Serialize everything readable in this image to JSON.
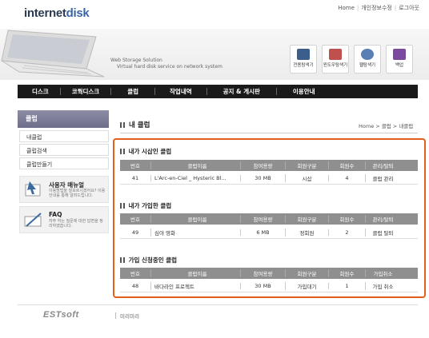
{
  "header": {
    "logo_part1": "internet",
    "logo_part2": "disk",
    "links": [
      "Home",
      "개인정보수정",
      "로그아웃"
    ]
  },
  "hero": {
    "slogan_line1": "Web Storage Solution",
    "slogan_line2": "Virtual hard disk service on network system",
    "quick_icons": [
      {
        "label": "전용탐색기",
        "icon": "monitor-icon",
        "color": "#3c5e8c"
      },
      {
        "label": "윈도우탐색기",
        "icon": "window-icon",
        "color": "#c0504d"
      },
      {
        "label": "웹탐색기",
        "icon": "web-search-icon",
        "color": "#5a7fb5"
      },
      {
        "label": "백업",
        "icon": "backup-icon",
        "color": "#7a4a9e"
      }
    ]
  },
  "nav": {
    "items": [
      "디스크",
      "코웍디스크",
      "클럽",
      "작업내역",
      "공지 & 게시판",
      "이용안내"
    ]
  },
  "sidebar": {
    "title": "클럽",
    "items": [
      "내클럽",
      "클럽검색",
      "클럽만들기"
    ],
    "promos": [
      {
        "title": "사용자 매뉴얼",
        "desc": "이용방법을 잘모르시겠어요? 이용안내를 통해 알려드립니다.",
        "icon": "manual-icon"
      },
      {
        "title": "FAQ",
        "desc": "자주 하는 질문에 대한 답변을 정리하였습니다.",
        "icon": "faq-icon"
      }
    ]
  },
  "main": {
    "title": "내 클럽",
    "breadcrumb": "Home > 클럽 > 내클럽",
    "sections": [
      {
        "title": "내가 시삽인 클럽",
        "columns": [
          "번호",
          "클럽이름",
          "참여용량",
          "회원구분",
          "회원수",
          "관리/탈퇴"
        ],
        "rows": [
          [
            "41",
            "L'Arc-en-Ciel _ Hysteric Bl...",
            "30 MB",
            "시삽",
            "4",
            "클럽 관리"
          ]
        ]
      },
      {
        "title": "내가 가입한 클럽",
        "columns": [
          "번호",
          "클럽이름",
          "참여용량",
          "회원구분",
          "회원수",
          "관리/탈퇴"
        ],
        "rows": [
          [
            "49",
            "심야 영화",
            "6 MB",
            "정회원",
            "2",
            "클럽 탈퇴"
          ]
        ]
      },
      {
        "title": "가입 신청중인 클럽",
        "columns": [
          "번호",
          "클럽이름",
          "참여용량",
          "회원구분",
          "회원수",
          "가입취소"
        ],
        "rows": [
          [
            "48",
            "바다라인 프로젝트",
            "30 MB",
            "가입대기",
            "1",
            "가입 취소"
          ]
        ]
      }
    ]
  },
  "footer": {
    "brand": "ESTsoft",
    "link": "미리미리"
  },
  "colors": {
    "highlight_frame": "#e0601a",
    "nav_bg": "#1a1a1a",
    "sidebar_head": "#7a7a96",
    "table_head": "#8f8f8f"
  }
}
